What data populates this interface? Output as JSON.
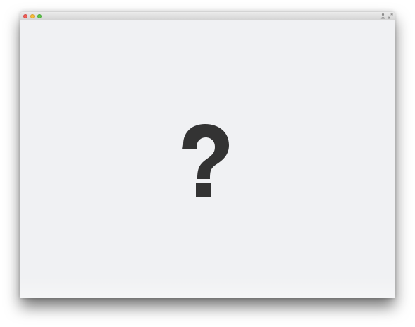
{
  "window": {
    "controls": {
      "close_color": "#f25f58",
      "minimize_color": "#f9be3a",
      "zoom_color": "#5fc74a"
    },
    "titlebar_icons": [
      "person-icon",
      "fullscreen-icon"
    ]
  },
  "content": {
    "background": "#f0f1f3",
    "placeholder_icon": "question-mark-icon",
    "icon_color": "#333333"
  }
}
